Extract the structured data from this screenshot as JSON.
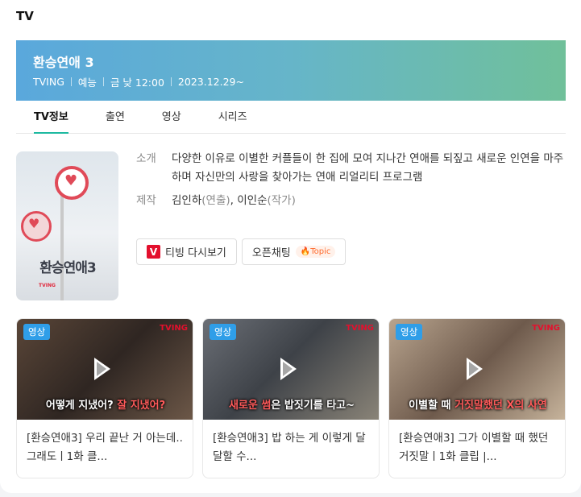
{
  "section_title": "TV",
  "show": {
    "title": "환승연애 3",
    "meta": [
      "TVING",
      "예능",
      "금 낮 12:00",
      "2023.12.29~"
    ]
  },
  "tabs": [
    "TV정보",
    "출연",
    "영상",
    "시리즈"
  ],
  "poster": {
    "title_text": "환승연애3",
    "brand_text": "TVING"
  },
  "info": {
    "intro_label": "소개",
    "intro_text": "다양한 이유로 이별한 커플들이 한 집에 모여 지나간 연애를 되짚고 새로운 인연을 마주하며 자신만의 사랑을 찾아가는 연애 리얼리티 프로그램",
    "production_label": "제작",
    "production_name_1": "김인하",
    "production_role_1": "(연출)",
    "production_sep": ", ",
    "production_name_2": "이인순",
    "production_role_2": "(작가)"
  },
  "buttons": {
    "rewatch_label": "티빙 다시보기",
    "rewatch_logo": "V",
    "openchat_label": "오픈채팅",
    "topic_label": "🔥Topic"
  },
  "videos": [
    {
      "badge": "영상",
      "brand": "TVING",
      "caption_plain": "어떻게 지냈어? ",
      "caption_highlight": "잘 지냈어?",
      "title": "[환승연애3] 우리 끝난 거 아는데.. 그래도ㅣ1화 클..."
    },
    {
      "badge": "영상",
      "brand": "TVING",
      "caption_plain": "은 밥짓기를 타고~",
      "caption_highlight": "새로운 썸",
      "title": "[환승연애3] 밥 하는 게 이렇게 달달할 수..."
    },
    {
      "badge": "영상",
      "brand": "TVING",
      "caption_plain": "이별할 때 ",
      "caption_highlight": "거짓말",
      "caption_tail": "했던 X의 사연",
      "title": "[환승연애3] 그가 이별할 때 했던 거짓말ㅣ1화 클립 |..."
    }
  ]
}
